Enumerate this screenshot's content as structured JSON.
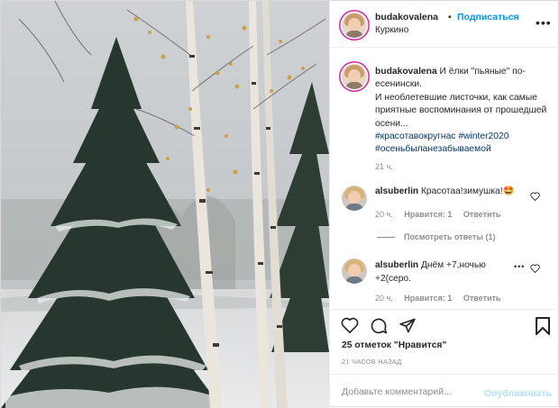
{
  "post": {
    "username": "budakovalena",
    "dot": "•",
    "follow_label": "Подписаться",
    "location": "Куркино",
    "more_label": "•••"
  },
  "caption": {
    "username": "budakovalena",
    "text_1": "И ёлки \"пьяные\" по-есенински.",
    "text_2": "И необлетевшие листочки, как самые приятные воспоминания от прошедшей осени...",
    "tag_1": "#красотавокругнас",
    "tag_2": "#winter2020",
    "tag_3": "#осеньбыланезабываемой",
    "time": "21 ч."
  },
  "comments": [
    {
      "username": "alsuberlin",
      "text": "Красотаа!зимушка!🤩",
      "time": "20 ч.",
      "likes": "Нравится: 1",
      "reply": "Ответить"
    },
    {
      "username": "alsuberlin",
      "text": "Днём +7,ночью +2(серо.",
      "time": "20 ч.",
      "likes": "Нравится: 1",
      "reply": "Ответить"
    }
  ],
  "view_replies": "Посмотреть ответы (1)",
  "likes_text": "25 отметок \"Нравится\"",
  "post_time": "21 ЧАСОВ НАЗАД",
  "comment_input": {
    "placeholder": "Добавьте комментарий...",
    "value": ""
  },
  "publish_label": "Опубликовать",
  "colors": {
    "link": "#0095f6",
    "hashtag": "#00376b",
    "secondary": "#8e8e8e",
    "publish_disabled": "#b2dffc",
    "story_ring": "#d6249f"
  }
}
